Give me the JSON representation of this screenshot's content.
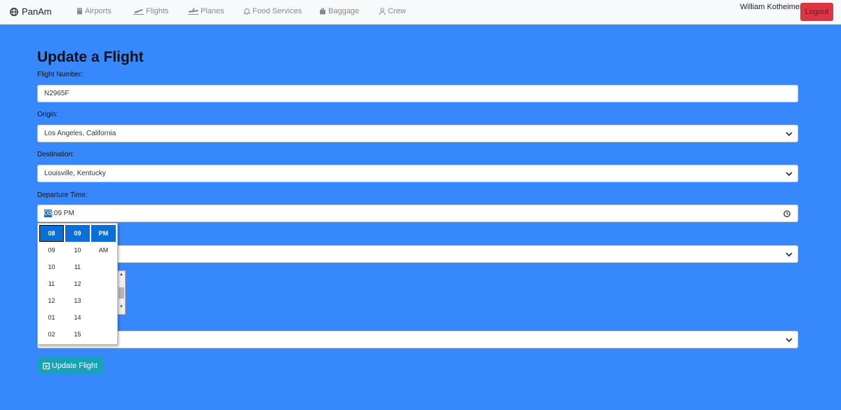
{
  "nav": {
    "brand": "PanAm",
    "items": [
      {
        "label": "Airports",
        "icon": "building-icon"
      },
      {
        "label": "Flights",
        "icon": "plane-departure-icon"
      },
      {
        "label": "Planes",
        "icon": "plane-icon"
      },
      {
        "label": "Food Services",
        "icon": "bell-icon"
      },
      {
        "label": "Baggage",
        "icon": "suitcase-icon"
      },
      {
        "label": "Crew",
        "icon": "user-icon"
      }
    ],
    "user": "William Kotheimer",
    "logout": "Logout"
  },
  "form": {
    "title": "Update a Flight",
    "flight_number_label": "Flight Number:",
    "flight_number": "N2965F",
    "origin_label": "Origin:",
    "origin": "Los Angeles, California",
    "destination_label": "Destination:",
    "destination": "Louisville, Kentucky",
    "departure_label": "Departure Time:",
    "departure_hour": "08",
    "departure_rest": ":09 PM",
    "submit": "Update Flight"
  },
  "time_picker": {
    "hours": [
      "08",
      "09",
      "10",
      "11",
      "12",
      "01",
      "02"
    ],
    "minutes": [
      "09",
      "10",
      "11",
      "12",
      "13",
      "14",
      "15"
    ],
    "periods": [
      "PM",
      "AM"
    ]
  },
  "colors": {
    "background": "#3788fd",
    "logout": "#dc3545",
    "submit": "#17a2b8",
    "selection": "#0a6fd6"
  }
}
